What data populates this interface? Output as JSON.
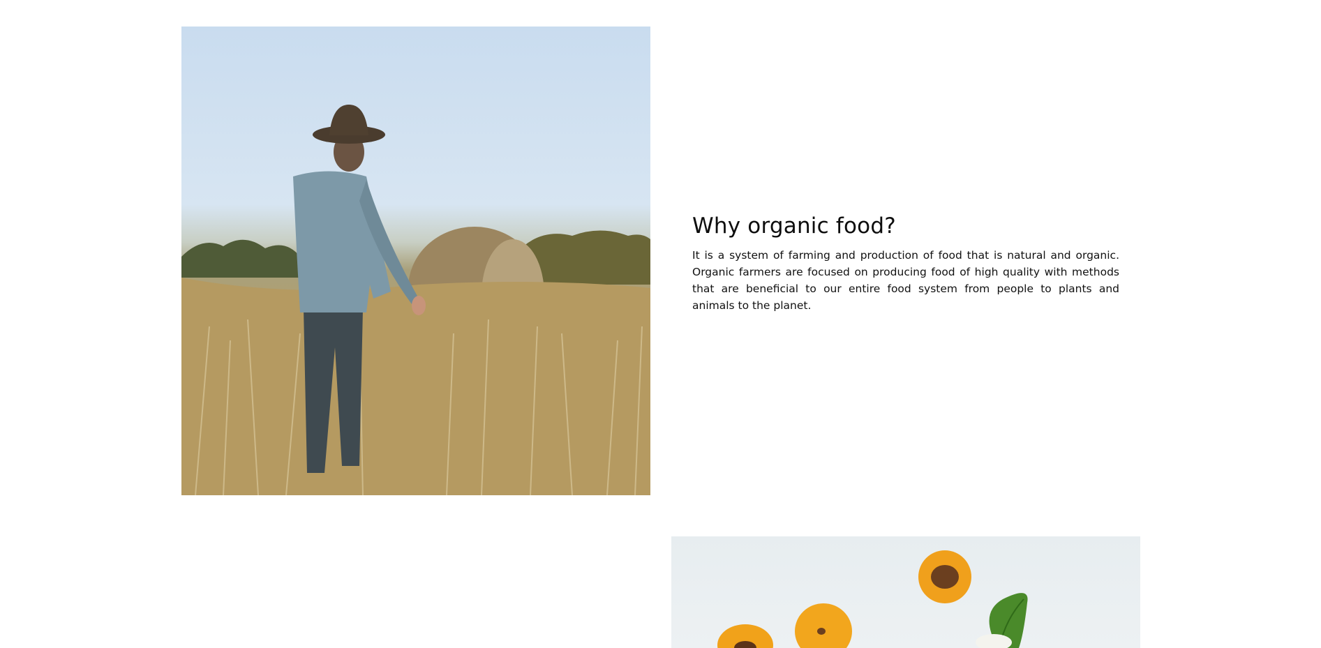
{
  "section": {
    "heading": "Why organic food?",
    "body": "It is a system of farming and production of food that is natural and organic. Organic farmers are focused on producing food of high quality with methods that are beneficial to our entire food system from people to plants and animals to the planet."
  },
  "images": {
    "farmer_photo_icon": "photo-farmer-in-field",
    "apricot_photo_icon": "photo-apricots-on-table"
  },
  "colors": {
    "heading": "#0d0d0d",
    "text": "#111111",
    "background": "#ffffff"
  }
}
